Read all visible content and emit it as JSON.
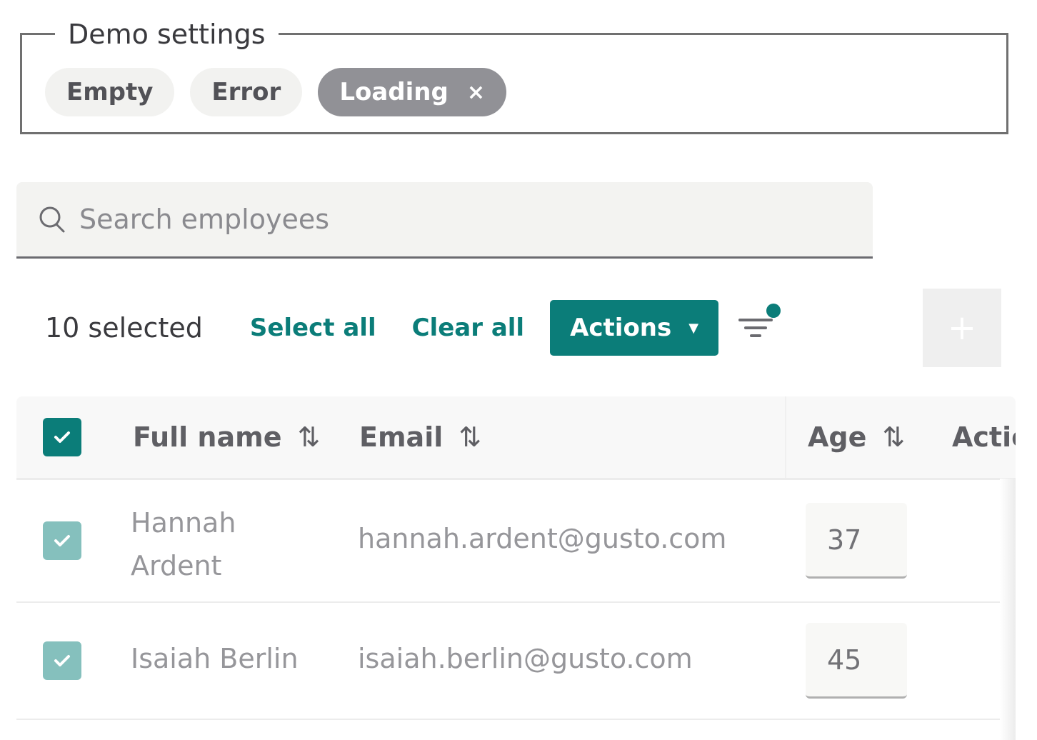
{
  "demo_settings": {
    "legend": "Demo settings",
    "chips": [
      {
        "label": "Empty",
        "active": false
      },
      {
        "label": "Error",
        "active": false
      },
      {
        "label": "Loading",
        "active": true,
        "remove_icon": "close-icon",
        "remove_glyph": "×"
      }
    ]
  },
  "search": {
    "placeholder": "Search employees",
    "value": "",
    "icon": "search-icon"
  },
  "toolbar": {
    "selected_count": "10 selected",
    "select_all": "Select all",
    "clear_all": "Clear all",
    "actions_label": "Actions",
    "actions_caret": "▼",
    "filter_icon": "filter-icon",
    "filter_active": true,
    "add_glyph": "+"
  },
  "colors": {
    "accent": "#0b7d79",
    "chip_active": "#919196"
  },
  "table": {
    "header_checked": true,
    "columns": [
      {
        "label": "Full name",
        "sort_glyph": "⇅"
      },
      {
        "label": "Email",
        "sort_glyph": "⇅"
      },
      {
        "label": "Age",
        "sort_glyph": "⇅"
      },
      {
        "label": "Actio"
      }
    ],
    "rows": [
      {
        "name_line1": "Hannah",
        "name_line2": "Ardent",
        "email": "hannah.ardent@gusto.com",
        "age": "37",
        "checked": true
      },
      {
        "name_line1": "Isaiah Berlin",
        "name_line2": "",
        "email": "isaiah.berlin@gusto.com",
        "age": "45",
        "checked": true
      }
    ]
  }
}
